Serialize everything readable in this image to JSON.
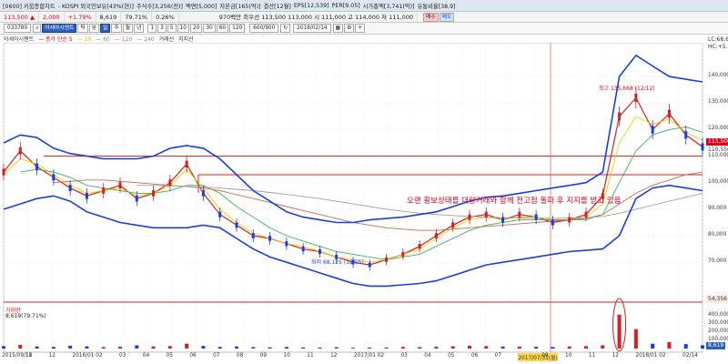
{
  "info_bar": {
    "items": [
      "[0600] 키움종합차트",
      "- KOSPI 외국인보유[43%(현)]",
      "주식수[3,256(천)]",
      "액면[5,000]",
      "자본금[165(억)]",
      "결산[12월]",
      "EPS[12,539]",
      "PER[9.05]",
      "시가총액[3,741(억)]",
      "유통비율[38.9]"
    ]
  },
  "price_bar": {
    "price": "113,500 ▲",
    "change": "2,000",
    "change_pct": "+1.79%",
    "volume": "8,619",
    "vol_pct": "79.71%",
    "turnover": "0.26%",
    "summary": "970백만 최우선 113,500  113,000 시 111,000 고 114,000 저 111,000",
    "buy": "매수",
    "sell": "매도"
  },
  "tool_row": {
    "code": "033780",
    "name": "아세아시멘트",
    "period_buttons": [
      "틱",
      "분",
      "일",
      "주",
      "월",
      "년"
    ],
    "interval_buttons": [
      "1",
      "3",
      "5",
      "10",
      "20",
      "30",
      "60",
      "120"
    ],
    "date": "2018/02/14",
    "count": "600/900"
  },
  "ma_row": {
    "title": "아세아시멘트",
    "items": [
      "종가 단순 5",
      "20",
      "60",
      "120",
      "240",
      "거래선",
      "지지선"
    ]
  },
  "chart_data": {
    "type": "line",
    "x_ticks": [
      "2015/09/10",
      "11",
      "12",
      "2016/01",
      "02",
      "03",
      "04",
      "05",
      "06",
      "07",
      "08",
      "09",
      "10",
      "11",
      "12",
      "2017/01",
      "02",
      "03",
      "04",
      "05",
      "06",
      "07",
      "2017/07/31(월)",
      "09",
      "10",
      "11",
      "12",
      "2018/01",
      "02",
      "02/14"
    ],
    "price_axis": [
      70000,
      80000,
      90000,
      100000,
      110000,
      120000,
      130000,
      140000
    ],
    "y_range": [
      56000,
      150000
    ],
    "volume_axis": [
      100000,
      200000,
      300000,
      400000
    ],
    "annotations": {
      "high": "최고 135,668 (12/12)",
      "low": "최저 68,125 (12/05)",
      "mid": "135,668",
      "text": "오랜 횡보상태를 대량거래와 함께 전고점 돌파 후 지지를 받고 있음"
    },
    "tags": {
      "top": "LC:68.60",
      "top2": "HC:+5.34",
      "price": "113,500",
      "ma": "110,556",
      "bottom": "54,356",
      "volume": "8,619"
    },
    "volume_label": "거래량",
    "volume_value": "8,619(79.71%)",
    "support_lines": [
      110000,
      103000
    ],
    "series": [
      {
        "name": "종가",
        "color": "#d42020",
        "values": [
          104000,
          112000,
          106000,
          102000,
          98000,
          95000,
          97000,
          99000,
          94000,
          96000,
          100000,
          107000,
          96000,
          88000,
          84000,
          80000,
          79000,
          77000,
          75000,
          74000,
          72000,
          70000,
          69000,
          71000,
          73000,
          76000,
          80000,
          84000,
          87000,
          88000,
          86000,
          88000,
          87000,
          85000,
          86000,
          88000,
          95000,
          125000,
          132000,
          120000,
          126000,
          118000,
          113500
        ]
      },
      {
        "name": "5",
        "color": "#e8d000",
        "values": [
          103000,
          109000,
          107000,
          103000,
          99000,
          96000,
          97000,
          98000,
          95000,
          96000,
          99000,
          105000,
          98000,
          90000,
          85000,
          81000,
          79000,
          77000,
          76000,
          74000,
          72000,
          71000,
          70000,
          71000,
          73000,
          75000,
          79000,
          83000,
          86000,
          87000,
          86000,
          87000,
          87000,
          86000,
          86000,
          87000,
          92000,
          115000,
          125000,
          122000,
          124000,
          119000,
          116000
        ]
      },
      {
        "name": "20",
        "color": "#40b060",
        "values": [
          null,
          104000,
          105000,
          104000,
          102000,
          99000,
          98000,
          97000,
          96000,
          96000,
          97000,
          99000,
          99000,
          96000,
          91000,
          87000,
          83000,
          80000,
          78000,
          76000,
          74000,
          73000,
          72000,
          71000,
          72000,
          73000,
          76000,
          79000,
          82000,
          84000,
          85000,
          86000,
          86000,
          86000,
          86000,
          86000,
          88000,
          100000,
          112000,
          118000,
          120000,
          121000,
          119000
        ]
      },
      {
        "name": "120",
        "color": "#c07050",
        "values": [
          null,
          null,
          null,
          100000,
          100500,
          101000,
          101000,
          100500,
          100000,
          99500,
          99000,
          98500,
          98000,
          97000,
          95500,
          94000,
          92500,
          91000,
          89500,
          88000,
          86500,
          85000,
          84000,
          83000,
          82500,
          82000,
          82000,
          82500,
          83000,
          83500,
          84000,
          84500,
          85000,
          85500,
          86000,
          86500,
          88000,
          92000,
          96000,
          99000,
          101000,
          103000,
          104000
        ]
      },
      {
        "name": "240",
        "color": "#a0a0a0",
        "values": [
          null,
          null,
          null,
          null,
          null,
          null,
          null,
          null,
          99000,
          99000,
          98800,
          98600,
          98300,
          98000,
          97500,
          97000,
          96300,
          95600,
          94800,
          94000,
          93000,
          92000,
          91000,
          90000,
          89200,
          88500,
          88000,
          87600,
          87300,
          87000,
          86800,
          86700,
          86600,
          86600,
          86700,
          86800,
          87300,
          88500,
          90000,
          91500,
          93000,
          94500,
          96000
        ]
      },
      {
        "name": "BB상단",
        "color": "#1a3fe0",
        "values": [
          115000,
          118000,
          117000,
          113000,
          111000,
          110000,
          109000,
          109000,
          109000,
          110000,
          113000,
          114000,
          113000,
          109000,
          103000,
          97000,
          93000,
          89000,
          87000,
          86000,
          85000,
          85000,
          86000,
          86500,
          87000,
          88000,
          89000,
          91000,
          93000,
          94500,
          95000,
          96000,
          97000,
          98000,
          99000,
          100000,
          104000,
          140000,
          148000,
          144000,
          140000,
          139000,
          138000
        ]
      },
      {
        "name": "BB하단",
        "color": "#1a3fe0",
        "values": [
          90000,
          92000,
          94000,
          95000,
          93000,
          89000,
          87000,
          85000,
          84000,
          83000,
          83000,
          83000,
          84000,
          83000,
          79000,
          75000,
          72000,
          70000,
          68000,
          66000,
          64000,
          62000,
          61000,
          61000,
          61500,
          62000,
          63000,
          65000,
          67000,
          69000,
          70000,
          71000,
          72000,
          73000,
          74000,
          74500,
          75000,
          80000,
          94000,
          98000,
          99000,
          98000,
          97000
        ]
      }
    ],
    "volume": [
      30,
      45,
      25,
      20,
      35,
      28,
      18,
      22,
      40,
      26,
      30,
      60,
      32,
      20,
      25,
      18,
      15,
      20,
      14,
      12,
      16,
      10,
      12,
      14,
      20,
      18,
      22,
      28,
      35,
      30,
      25,
      24,
      22,
      20,
      26,
      30,
      40,
      420,
      240,
      60,
      80,
      55,
      40
    ]
  }
}
